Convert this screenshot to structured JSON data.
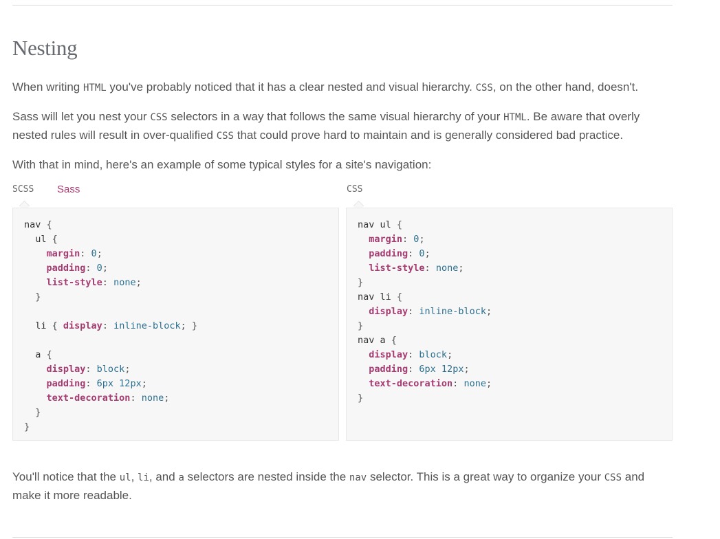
{
  "section": {
    "title": "Nesting",
    "p1": {
      "t1": "When writing ",
      "c1": "HTML",
      "t2": " you've probably noticed that it has a clear nested and visual hierarchy. ",
      "c2": "CSS",
      "t3": ", on the other hand, doesn't."
    },
    "p2": {
      "t1": "Sass will let you nest your ",
      "c1": "CSS",
      "t2": " selectors in a way that follows the same visual hierarchy of your ",
      "c2": "HTML",
      "t3": ". Be aware that overly nested rules will result in over-qualified ",
      "c3": "CSS",
      "t4": " that could prove hard to maintain and is generally considered bad practice."
    },
    "p3": "With that in mind, here's an example of some typical styles for a site's navigation:",
    "p4": {
      "t1": "You'll notice that the ",
      "c1": "ul",
      "t2": ", ",
      "c2": "li",
      "t3": ", and ",
      "c3": "a",
      "t4": " selectors are nested inside the ",
      "c4": "nav",
      "t5": " selector. This is a great way to organize your ",
      "c5": "CSS",
      "t6": " and make it more readable."
    }
  },
  "tabs": {
    "scss": "SCSS",
    "sass": "Sass",
    "css": "CSS"
  },
  "scss_code": [
    [
      [
        "sel",
        "nav "
      ],
      [
        "brace",
        "{"
      ]
    ],
    [
      [
        "sel",
        "  ul "
      ],
      [
        "brace",
        "{"
      ]
    ],
    [
      [
        "prop",
        "    margin"
      ],
      [
        "brace",
        ": "
      ],
      [
        "val",
        "0"
      ],
      [
        "brace",
        ";"
      ]
    ],
    [
      [
        "prop",
        "    padding"
      ],
      [
        "brace",
        ": "
      ],
      [
        "val",
        "0"
      ],
      [
        "brace",
        ";"
      ]
    ],
    [
      [
        "prop",
        "    list-style"
      ],
      [
        "brace",
        ": "
      ],
      [
        "val",
        "none"
      ],
      [
        "brace",
        ";"
      ]
    ],
    [
      [
        "brace",
        "  }"
      ]
    ],
    [],
    [
      [
        "sel",
        "  li "
      ],
      [
        "brace",
        "{ "
      ],
      [
        "prop",
        "display"
      ],
      [
        "brace",
        ": "
      ],
      [
        "val",
        "inline-block"
      ],
      [
        "brace",
        "; }"
      ]
    ],
    [],
    [
      [
        "sel",
        "  a "
      ],
      [
        "brace",
        "{"
      ]
    ],
    [
      [
        "prop",
        "    display"
      ],
      [
        "brace",
        ": "
      ],
      [
        "val",
        "block"
      ],
      [
        "brace",
        ";"
      ]
    ],
    [
      [
        "prop",
        "    padding"
      ],
      [
        "brace",
        ": "
      ],
      [
        "val",
        "6px 12px"
      ],
      [
        "brace",
        ";"
      ]
    ],
    [
      [
        "prop",
        "    text-decoration"
      ],
      [
        "brace",
        ": "
      ],
      [
        "val",
        "none"
      ],
      [
        "brace",
        ";"
      ]
    ],
    [
      [
        "brace",
        "  }"
      ]
    ],
    [
      [
        "brace",
        "}"
      ]
    ]
  ],
  "css_code": [
    [
      [
        "sel",
        "nav ul "
      ],
      [
        "brace",
        "{"
      ]
    ],
    [
      [
        "prop",
        "  margin"
      ],
      [
        "brace",
        ": "
      ],
      [
        "val",
        "0"
      ],
      [
        "brace",
        ";"
      ]
    ],
    [
      [
        "prop",
        "  padding"
      ],
      [
        "brace",
        ": "
      ],
      [
        "val",
        "0"
      ],
      [
        "brace",
        ";"
      ]
    ],
    [
      [
        "prop",
        "  list-style"
      ],
      [
        "brace",
        ": "
      ],
      [
        "val",
        "none"
      ],
      [
        "brace",
        ";"
      ]
    ],
    [
      [
        "brace",
        "}"
      ]
    ],
    [
      [
        "sel",
        "nav li "
      ],
      [
        "brace",
        "{"
      ]
    ],
    [
      [
        "prop",
        "  display"
      ],
      [
        "brace",
        ": "
      ],
      [
        "val",
        "inline-block"
      ],
      [
        "brace",
        ";"
      ]
    ],
    [
      [
        "brace",
        "}"
      ]
    ],
    [
      [
        "sel",
        "nav a "
      ],
      [
        "brace",
        "{"
      ]
    ],
    [
      [
        "prop",
        "  display"
      ],
      [
        "brace",
        ": "
      ],
      [
        "val",
        "block"
      ],
      [
        "brace",
        ";"
      ]
    ],
    [
      [
        "prop",
        "  padding"
      ],
      [
        "brace",
        ": "
      ],
      [
        "val",
        "6px 12px"
      ],
      [
        "brace",
        ";"
      ]
    ],
    [
      [
        "prop",
        "  text-decoration"
      ],
      [
        "brace",
        ": "
      ],
      [
        "val",
        "none"
      ],
      [
        "brace",
        ";"
      ]
    ],
    [
      [
        "brace",
        "}"
      ]
    ]
  ]
}
